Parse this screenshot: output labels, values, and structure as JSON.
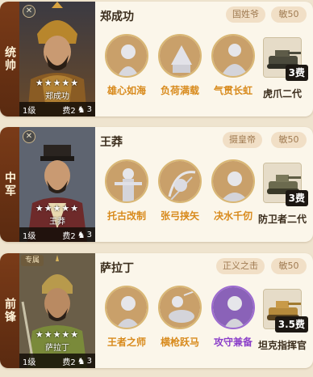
{
  "heroes": [
    {
      "position": "统帅",
      "name": "郑成功",
      "portrait_name": "郑成功",
      "stars": "★★★★★",
      "level": "1级",
      "cost": "费2",
      "troop": "3",
      "trait": "国姓爷",
      "speed": "敏50",
      "special_tag": "",
      "skills": [
        "雄心如海",
        "负荷满载",
        "气贯长虹"
      ],
      "equip": {
        "cost": "3费",
        "name": "虎爪二代"
      }
    },
    {
      "position": "中军",
      "name": "王莽",
      "portrait_name": "王莽",
      "stars": "★★★★★",
      "level": "1级",
      "cost": "费2",
      "troop": "3",
      "trait": "摄皇帝",
      "speed": "敏50",
      "special_tag": "",
      "skills": [
        "托古改制",
        "张弓挟矢",
        "决水千仞"
      ],
      "equip": {
        "cost": "3费",
        "name": "防卫者二代"
      }
    },
    {
      "position": "前锋",
      "name": "萨拉丁",
      "portrait_name": "萨拉丁",
      "stars": "★★★★★",
      "level": "1级",
      "cost": "费2",
      "troop": "3",
      "trait": "正义之击",
      "speed": "敏50",
      "special_tag": "专属",
      "skills": [
        "王者之师",
        "横枪跃马",
        "攻守兼备"
      ],
      "equip": {
        "cost": "3.5费",
        "name": "坦克指挥官"
      }
    }
  ],
  "colors": {
    "position_strip": "#6a3214",
    "skill_label": "#d88a1c",
    "skill_label_purple": "#8b3fc9",
    "badge_bg": "#f1dfc6"
  }
}
